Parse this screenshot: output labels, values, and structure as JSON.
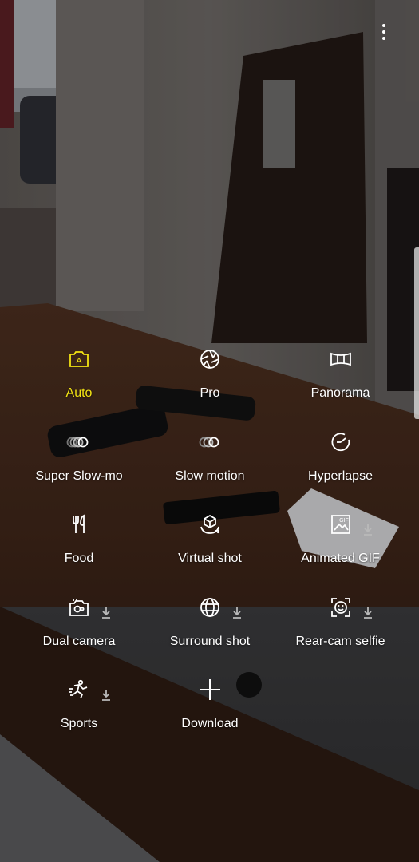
{
  "colors": {
    "active": "#f2e313",
    "label": "#ffffff",
    "download_badge": "#b9b9b9"
  },
  "top_bar": {
    "more_icon": "more-vertical-icon"
  },
  "modes": [
    {
      "label": "Auto",
      "icon": "auto-camera-icon",
      "active": true,
      "downloadable": false
    },
    {
      "label": "Pro",
      "icon": "aperture-icon",
      "active": false,
      "downloadable": false
    },
    {
      "label": "Panorama",
      "icon": "panorama-icon",
      "active": false,
      "downloadable": false
    },
    {
      "label": "Super Slow-mo",
      "icon": "super-slow-mo-icon",
      "active": false,
      "downloadable": false
    },
    {
      "label": "Slow motion",
      "icon": "slow-motion-icon",
      "active": false,
      "downloadable": false
    },
    {
      "label": "Hyperlapse",
      "icon": "hyperlapse-icon",
      "active": false,
      "downloadable": false
    },
    {
      "label": "Food",
      "icon": "food-icon",
      "active": false,
      "downloadable": false
    },
    {
      "label": "Virtual shot",
      "icon": "virtual-shot-icon",
      "active": false,
      "downloadable": false
    },
    {
      "label": "Animated GIF",
      "icon": "gif-icon",
      "active": false,
      "downloadable": true
    },
    {
      "label": "Dual camera",
      "icon": "dual-camera-icon",
      "active": false,
      "downloadable": true
    },
    {
      "label": "Surround shot",
      "icon": "surround-shot-icon",
      "active": false,
      "downloadable": true
    },
    {
      "label": "Rear-cam selfie",
      "icon": "rear-cam-selfie-icon",
      "active": false,
      "downloadable": true
    },
    {
      "label": "Sports",
      "icon": "sports-icon",
      "active": false,
      "downloadable": true
    },
    {
      "label": "Download",
      "icon": "plus-icon",
      "active": false,
      "downloadable": false
    }
  ]
}
